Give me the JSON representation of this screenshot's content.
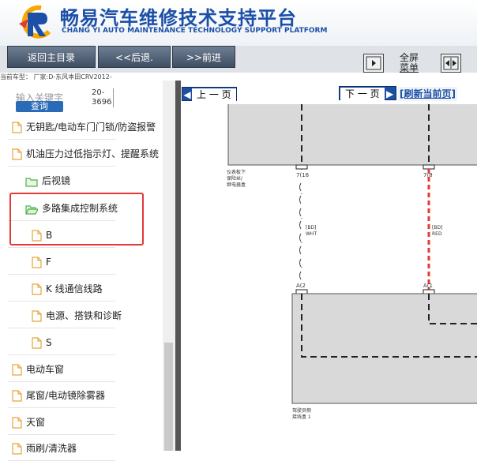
{
  "header": {
    "title_cn": "畅易汽车维修技术支持平台",
    "title_en": "CHANG YI AUTO MAINTENANCE TECHNOLOGY SUPPORT PLATFORM"
  },
  "toolbar": {
    "home_label": "返回主目录",
    "back_label": "<<后退.",
    "forward_label": ">>前进",
    "fullscreen_label_1": "全屏",
    "fullscreen_label_2": "菜单"
  },
  "car_line": "当前车型： 厂家:D-东风本田CRV2012-",
  "sidebar": {
    "search_placeholder": "输入关键字",
    "search_button": "查询",
    "car_year_1": "20-",
    "car_year_2": "3696",
    "items": [
      {
        "label": "无钥匙/电动车门门锁/防盗报警",
        "type": "file"
      },
      {
        "label": "机油压力过低指示灯、提醒系统",
        "type": "file"
      },
      {
        "label": "后视镜",
        "type": "folder"
      },
      {
        "label": "多路集成控制系统",
        "type": "folder-open"
      },
      {
        "label": "B",
        "type": "file"
      },
      {
        "label": "F",
        "type": "file"
      },
      {
        "label": "K 线通信线路",
        "type": "file"
      },
      {
        "label": "电源、搭铁和诊断",
        "type": "file"
      },
      {
        "label": "S",
        "type": "file"
      },
      {
        "label": "电动车窗",
        "type": "file"
      },
      {
        "label": "尾窗/电动镜除雾器",
        "type": "file"
      },
      {
        "label": "天窗",
        "type": "file"
      },
      {
        "label": "雨刷/清洗器",
        "type": "file"
      }
    ]
  },
  "doc_nav": {
    "prev_label": "上 一 页",
    "next_label": "下 一 页",
    "refresh_label": "[刷新当前页]"
  },
  "diagram": {
    "top_box_label_1": "仪表板下",
    "top_box_label_2": "保险丝/",
    "top_box_label_3": "继电器盒",
    "pin_left_top": "7(16",
    "pin_right_top": "7(8",
    "wire_left_tag": "[BD]",
    "wire_left_color": "WHT",
    "wire_right_tag": "[BD]",
    "wire_right_color": "RED",
    "pin_left_bottom": "A(2",
    "pin_right_bottom": "A(1",
    "bottom_box_label_1": "驾驶员侧",
    "bottom_box_label_2": "接线盒 1"
  }
}
